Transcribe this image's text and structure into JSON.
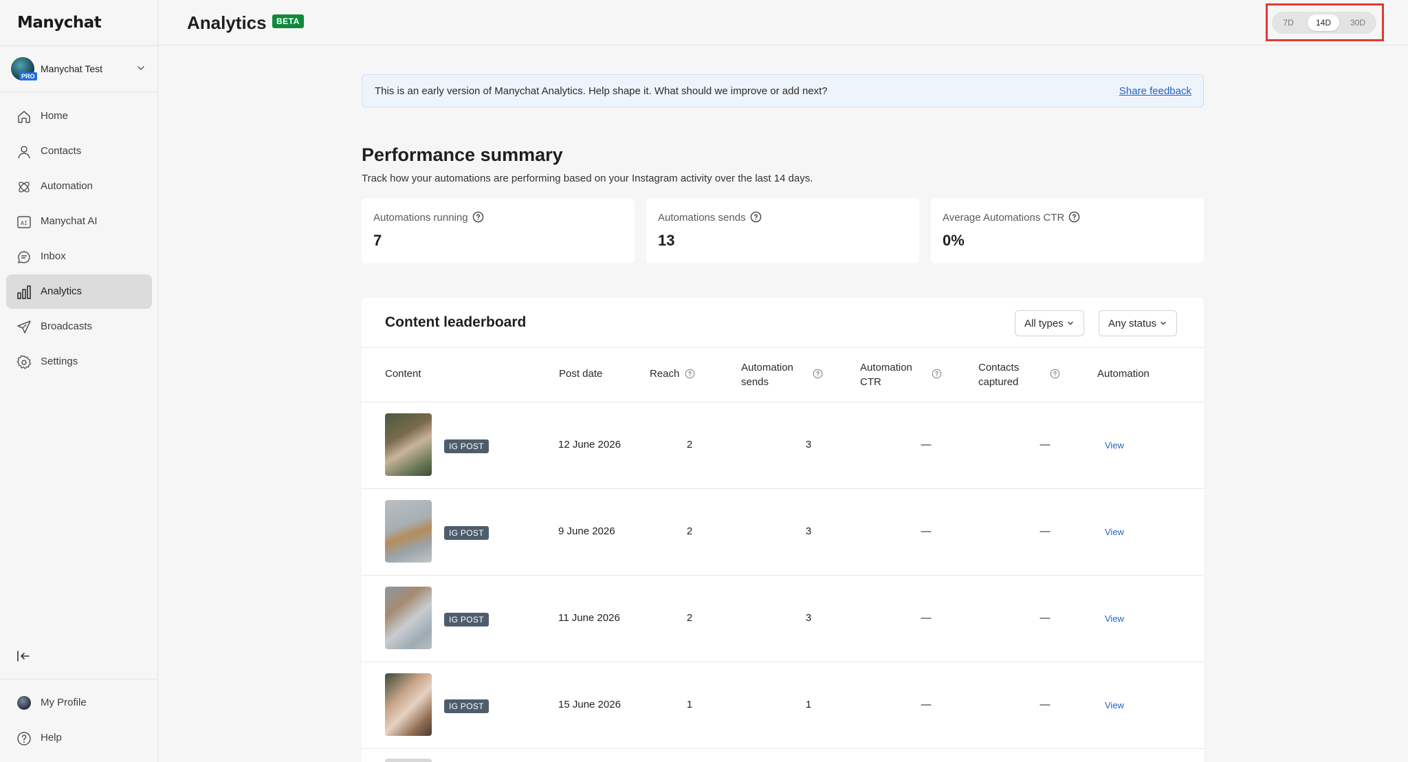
{
  "app": {
    "logo": "Manychat",
    "account_name": "Manychat Test",
    "account_badge": "PRO"
  },
  "nav": {
    "items": [
      {
        "label": "Home",
        "icon": "home-icon"
      },
      {
        "label": "Contacts",
        "icon": "person-icon"
      },
      {
        "label": "Automation",
        "icon": "automation-icon"
      },
      {
        "label": "Manychat AI",
        "icon": "ai-icon"
      },
      {
        "label": "Inbox",
        "icon": "chat-icon"
      },
      {
        "label": "Analytics",
        "icon": "bar-chart-icon",
        "active": true
      },
      {
        "label": "Broadcasts",
        "icon": "send-icon"
      },
      {
        "label": "Settings",
        "icon": "gear-icon"
      }
    ],
    "bottom": [
      {
        "label": "My Profile",
        "icon": "profile-avatar"
      },
      {
        "label": "Help",
        "icon": "help-icon"
      }
    ]
  },
  "header": {
    "title": "Analytics",
    "badge": "BETA",
    "ranges": [
      "7D",
      "14D",
      "30D"
    ],
    "selected_range": "14D"
  },
  "banner": {
    "text": "This is an early version of Manychat Analytics. Help shape it. What should we improve or add next?",
    "link": "Share feedback"
  },
  "summary": {
    "title": "Performance summary",
    "subtitle": "Track how your automations are performing based on your Instagram activity over the last 14 days.",
    "cards": [
      {
        "label": "Automations running",
        "value": "7"
      },
      {
        "label": "Automations sends",
        "value": "13"
      },
      {
        "label": "Average Automations CTR",
        "value": "0%"
      }
    ]
  },
  "leaderboard": {
    "title": "Content leaderboard",
    "filters": {
      "type": "All types",
      "status": "Any status"
    },
    "columns": {
      "content": "Content",
      "post_date": "Post date",
      "reach": "Reach",
      "sends_1": "Automation",
      "sends_2": "sends",
      "ctr_1": "Automation",
      "ctr_2": "CTR",
      "contacts_1": "Contacts",
      "contacts_2": "captured",
      "automation": "Automation"
    },
    "rows": [
      {
        "tag": "IG POST",
        "date": "12 June 2026",
        "reach": "2",
        "sends": "3",
        "ctr": "—",
        "contacts": "—",
        "action": "View"
      },
      {
        "tag": "IG POST",
        "date": "9 June 2026",
        "reach": "2",
        "sends": "3",
        "ctr": "—",
        "contacts": "—",
        "action": "View"
      },
      {
        "tag": "IG POST",
        "date": "11 June 2026",
        "reach": "2",
        "sends": "3",
        "ctr": "—",
        "contacts": "—",
        "action": "View"
      },
      {
        "tag": "IG POST",
        "date": "15 June 2026",
        "reach": "1",
        "sends": "1",
        "ctr": "—",
        "contacts": "—",
        "action": "View"
      }
    ]
  },
  "colors": {
    "accent_link": "#1f63c6",
    "beta_badge": "#0f8a3c",
    "highlight_outline": "#e03a2f",
    "tag_bg": "#4e5d6c"
  }
}
